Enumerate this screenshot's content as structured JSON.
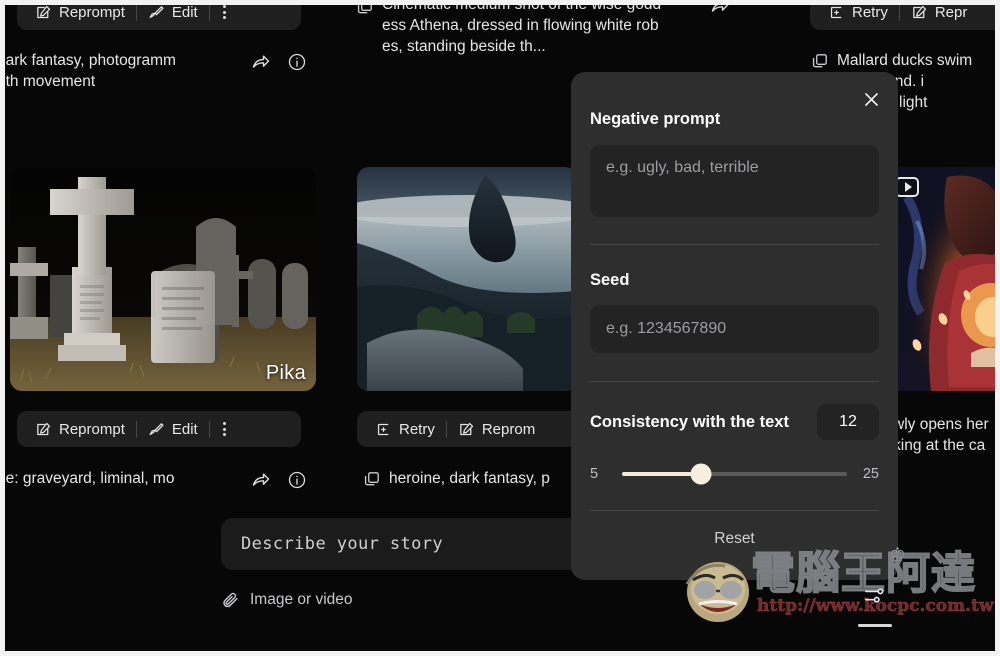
{
  "app": {
    "background_color": "#070707",
    "accent_color": "#f6eede",
    "panel_color": "#2e2e2f"
  },
  "columns": [
    {
      "id": "left",
      "top_toolbar": {
        "reprompt_label": "Reprompt",
        "edit_label": "Edit",
        "more_label": "More options"
      },
      "top_caption": "dark fantasy, photogramm\noth movement",
      "tile": {
        "watermark": "Pika",
        "alt": "graveyard-with-stone-cross-and-headstones"
      },
      "bottom_toolbar": {
        "reprompt_label": "Reprompt",
        "edit_label": "Edit",
        "more_label": "More options"
      },
      "bottom_caption": "ne: graveyard, liminal, mo"
    },
    {
      "id": "middle",
      "top_caption": "Cinematic medium shot of the wise godd\ness Athena, dressed in flowing white rob\nes, standing beside th...",
      "tile": {
        "alt": "moonlit-rocky-coastline-seascape"
      },
      "bottom_toolbar": {
        "retry_label": "Retry",
        "reprompt_label": "Reprom"
      },
      "bottom_caption": "heroine, dark fantasy, p"
    },
    {
      "id": "right",
      "top_toolbar": {
        "retry_label": "Retry",
        "reprompt_label": "Repr"
      },
      "top_caption": "Mallard ducks swim\nsmall pond. i\ndynamic light",
      "tile": {
        "alt": "woman-in-red-jacket-with-glowing-lantern"
      },
      "bottom_caption": "wly opens her\nking at the ca"
    }
  ],
  "composer": {
    "placeholder": "Describe your story",
    "attach_label": "Image or video"
  },
  "settings_popover": {
    "close_label": "Close",
    "negative_prompt": {
      "label": "Negative prompt",
      "value": "",
      "placeholder": "e.g. ugly, bad, terrible"
    },
    "seed": {
      "label": "Seed",
      "value": "",
      "placeholder": "e.g. 1234567890"
    },
    "consistency": {
      "label": "Consistency with the text",
      "value": "12",
      "min": "5",
      "max": "25",
      "min_num": 5,
      "max_num": 25,
      "value_num": 12
    },
    "reset_label": "Reset"
  },
  "watermark": {
    "brand": "電腦王阿達",
    "url": "http://www.kocpc.com.tw",
    "crown": "♔"
  },
  "icons": {
    "reprompt": "pencil-square-icon",
    "edit": "brush-icon",
    "retry": "plus-box-icon",
    "more": "kebab-menu-icon",
    "share": "share-arrow-icon",
    "info": "info-circle-icon",
    "copy": "copy-icon",
    "attach": "paperclip-icon",
    "close": "close-icon",
    "play": "play-badge-icon",
    "mixer": "sliders-icon"
  }
}
